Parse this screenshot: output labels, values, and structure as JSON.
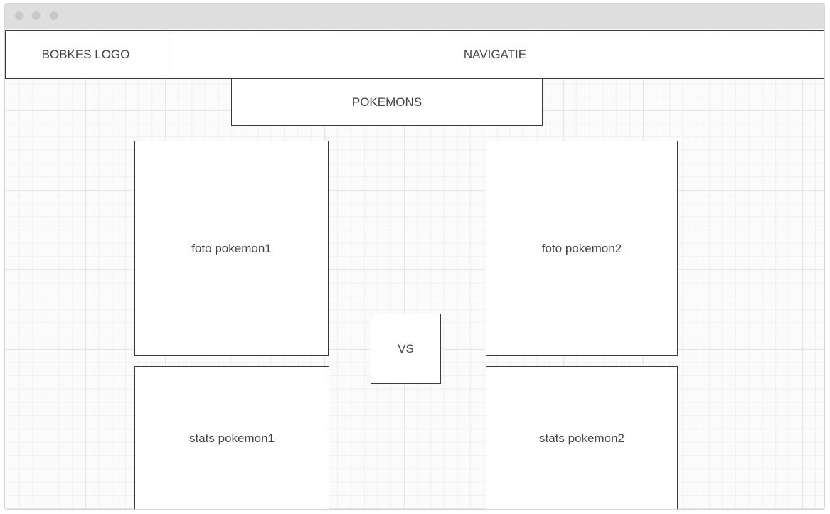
{
  "header": {
    "logo_label": "BOBKES LOGO",
    "navigation_label": "NAVIGATIE"
  },
  "page": {
    "section_title": "POKEMONS"
  },
  "battle": {
    "left": {
      "photo_label": "foto pokemon1",
      "stats_label": "stats pokemon1"
    },
    "versus_label": "VS",
    "right": {
      "photo_label": "foto pokemon2",
      "stats_label": "stats pokemon2"
    }
  },
  "colors": {
    "titlebar": "#dedede",
    "window_dots": "#c8c8c8",
    "box_border": "#3a3a3a",
    "text": "#444444",
    "grid_line": "#e6e6e6"
  }
}
